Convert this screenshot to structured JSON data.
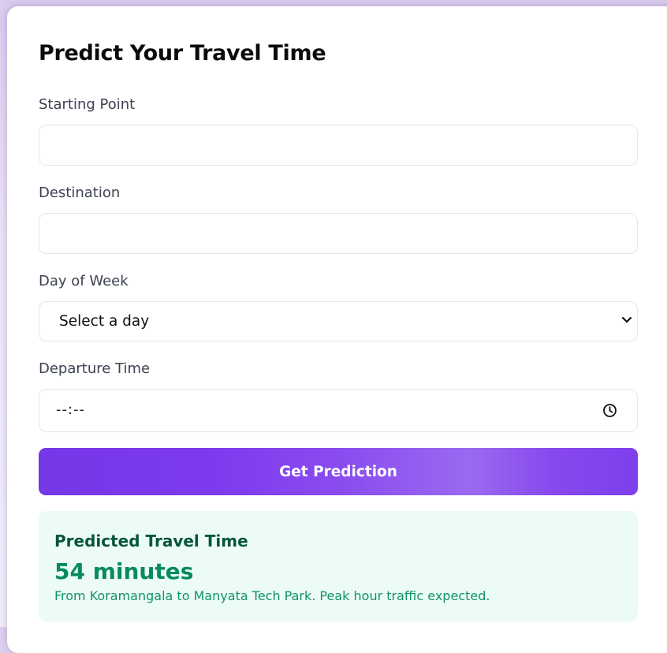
{
  "form": {
    "title": "Predict Your Travel Time",
    "start": {
      "label": "Starting Point",
      "value": "",
      "placeholder": ""
    },
    "destination": {
      "label": "Destination",
      "value": "",
      "placeholder": ""
    },
    "day": {
      "label": "Day of Week",
      "selected": "Select a day"
    },
    "time": {
      "label": "Departure Time",
      "value": "--:--"
    },
    "submit_label": "Get Prediction"
  },
  "result": {
    "title": "Predicted Travel Time",
    "value": "54 minutes",
    "description": "From Koramangala to Manyata Tech Park. Peak hour traffic expected."
  },
  "colors": {
    "accent": "#7c3aed",
    "result_bg": "#ecfbf4",
    "result_text": "#078a5f"
  },
  "icons": {
    "select": "chevron-down-icon",
    "time": "clock-icon"
  }
}
